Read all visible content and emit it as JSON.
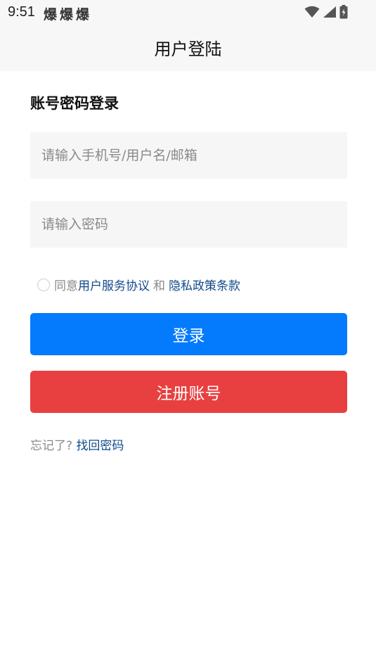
{
  "status_bar": {
    "time": "9:51",
    "notifications": "爆爆爆",
    "icons": [
      "wifi-icon",
      "signal-icon",
      "battery-charging-icon"
    ]
  },
  "header": {
    "title": "用户登陆"
  },
  "form": {
    "section_title": "账号密码登录",
    "account_placeholder": "请输入手机号/用户名/邮箱",
    "password_placeholder": "请输入密码",
    "agree_prefix": "同意",
    "service_link": "用户服务协议",
    "and_text": "和",
    "privacy_link": "隐私政策条款",
    "login_label": "登录",
    "register_label": "注册账号",
    "forgot_text": "忘记了?",
    "recover_link": "找回密码"
  },
  "colors": {
    "login_button": "#047bfd",
    "register_button": "#e84040",
    "link": "#114a8a"
  }
}
